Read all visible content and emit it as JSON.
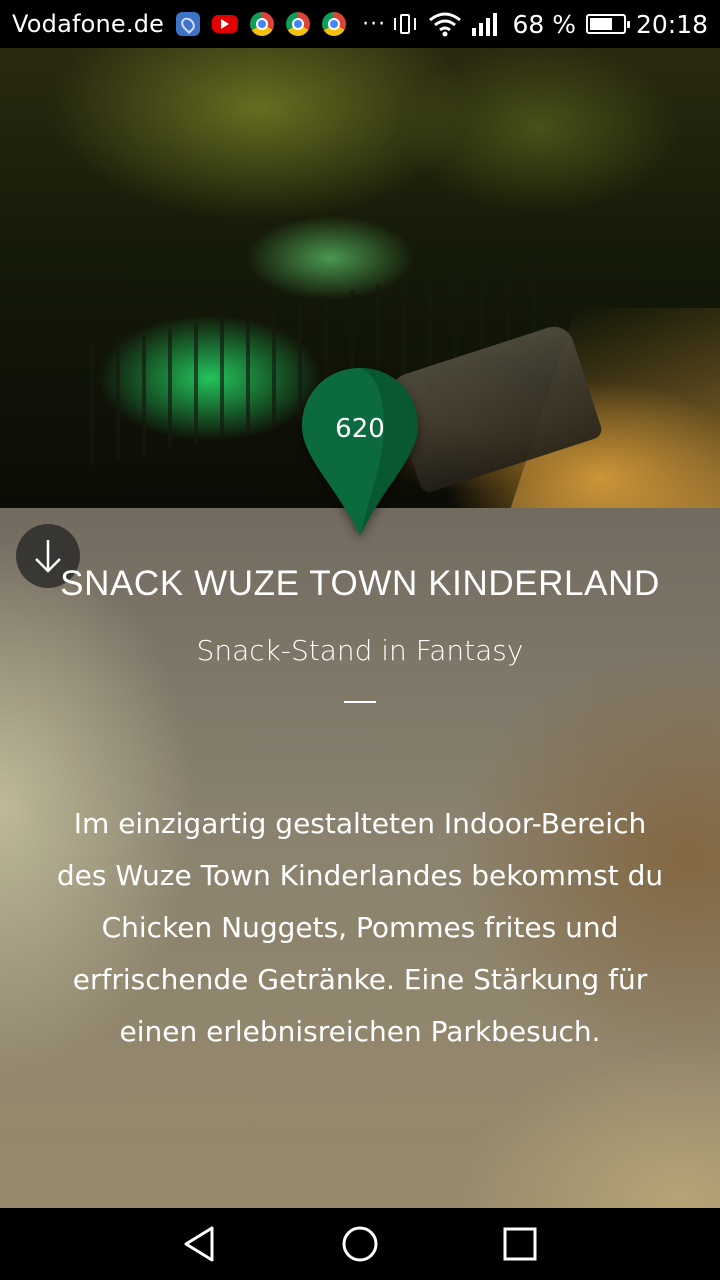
{
  "status_bar": {
    "carrier": "Vodafone.de",
    "more": "···",
    "battery_percent": "68 %",
    "battery_level": 0.68,
    "time": "20:18",
    "icons": [
      "maps-icon",
      "youtube-icon",
      "chrome-icon",
      "chrome-icon",
      "chrome-icon",
      "vibrate-icon",
      "wifi-icon",
      "signal-icon",
      "battery-icon"
    ]
  },
  "marker": {
    "number": "620",
    "color": "#0c6b3c"
  },
  "content": {
    "title": "SNACK WUZE TOWN KINDERLAND",
    "subtitle": "Snack-Stand in Fantasy",
    "description": "Im einzigartig gestalteten Indoor-Bereich des Wuze Town Kinderlandes bekommst du Chicken Nuggets, Pommes frites und erfrischende Getränke. Eine Stärkung für einen erlebnisreichen Parkbesuch."
  },
  "nav_bar": {
    "buttons": [
      "back-icon",
      "home-icon",
      "recents-icon"
    ]
  }
}
